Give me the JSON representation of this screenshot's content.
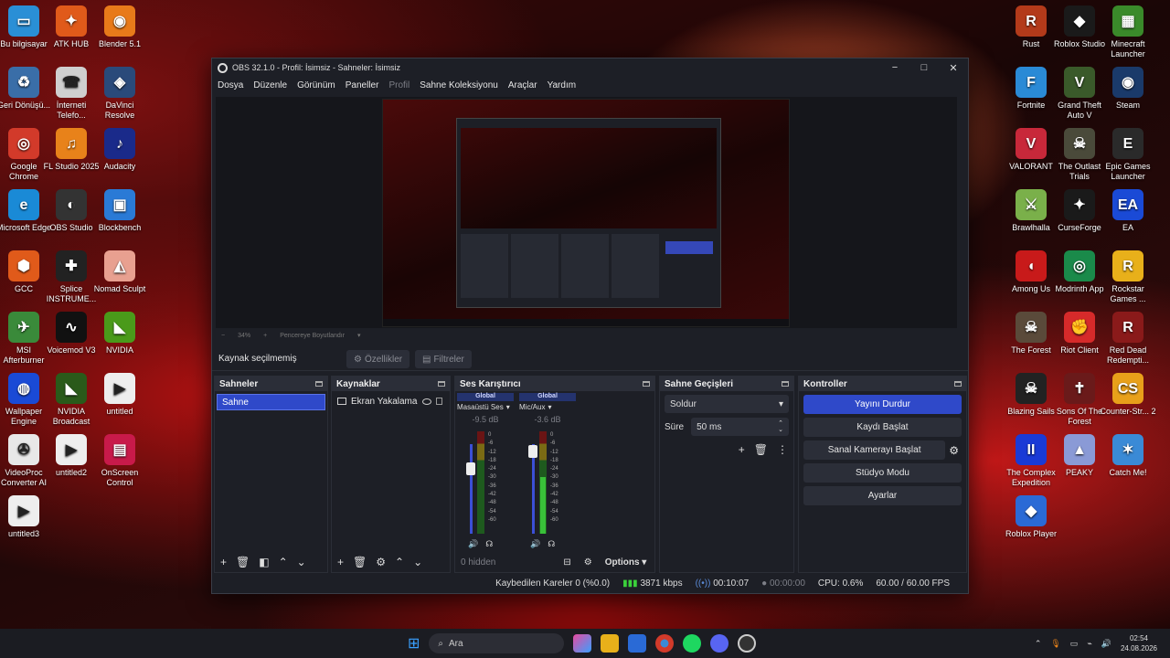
{
  "desktop_left": [
    {
      "label": "Bu bilgisayar",
      "glyph": "▭",
      "color": "#2a8fd6",
      "icon": "computer-icon"
    },
    {
      "label": "ATK HUB",
      "glyph": "✦",
      "color": "#e05a1a",
      "icon": "atk-hub-icon"
    },
    {
      "label": "Blender 5.1",
      "glyph": "◉",
      "color": "#e87a1a",
      "icon": "blender-icon"
    },
    {
      "label": "Geri Dönüşü...",
      "glyph": "♻",
      "color": "#3a6ea8",
      "icon": "recycle-bin-icon"
    },
    {
      "label": "İnterneti Telefo...",
      "glyph": "☎",
      "color": "#cfcfcf",
      "icon": "phone-link-icon"
    },
    {
      "label": "DaVinci Resolve",
      "glyph": "◈",
      "color": "#2a4a7a",
      "icon": "davinci-icon"
    },
    {
      "label": "Google Chrome",
      "glyph": "◎",
      "color": "#d23a2a",
      "icon": "chrome-icon"
    },
    {
      "label": "FL Studio 2025",
      "glyph": "♫",
      "color": "#e8821a",
      "icon": "fl-studio-icon"
    },
    {
      "label": "Audacity",
      "glyph": "♪",
      "color": "#1a2a8a",
      "icon": "audacity-icon"
    },
    {
      "label": "Microsoft Edge",
      "glyph": "e",
      "color": "#1a8ad6",
      "icon": "edge-icon"
    },
    {
      "label": "OBS Studio",
      "glyph": "◐",
      "color": "#333",
      "icon": "obs-icon"
    },
    {
      "label": "Blockbench",
      "glyph": "▣",
      "color": "#2a7ad6",
      "icon": "blockbench-icon"
    },
    {
      "label": "GCC",
      "glyph": "⬢",
      "color": "#e05a1a",
      "icon": "gcc-icon"
    },
    {
      "label": "Splice INSTRUME...",
      "glyph": "✚",
      "color": "#222",
      "icon": "splice-icon"
    },
    {
      "label": "Nomad Sculpt",
      "glyph": "◭",
      "color": "#e8a090",
      "icon": "nomad-icon"
    },
    {
      "label": "MSI Afterburner",
      "glyph": "✈",
      "color": "#3a8a3a",
      "icon": "afterburner-icon"
    },
    {
      "label": "Voicemod V3",
      "glyph": "∿",
      "color": "#111",
      "icon": "voicemod-icon"
    },
    {
      "label": "NVIDIA",
      "glyph": "◣",
      "color": "#4a9a1a",
      "icon": "nvidia-icon"
    },
    {
      "label": "Wallpaper Engine",
      "glyph": "◍",
      "color": "#1a4ad6",
      "icon": "wallpaper-engine-icon"
    },
    {
      "label": "NVIDIA Broadcast",
      "glyph": "◣",
      "color": "#2a5a1a",
      "icon": "nvidia-broadcast-icon"
    },
    {
      "label": "untitled",
      "glyph": "▶",
      "color": "#eee",
      "icon": "video-file-icon"
    },
    {
      "label": "VideoProc Converter AI",
      "glyph": "✇",
      "color": "#e8e8e8",
      "icon": "videoproc-icon"
    },
    {
      "label": "untitled2",
      "glyph": "▶",
      "color": "#eee",
      "icon": "video-file-icon"
    },
    {
      "label": "OnScreen Control",
      "glyph": "▤",
      "color": "#c81a4a",
      "icon": "onscreen-control-icon"
    },
    {
      "label": "untitled3",
      "glyph": "▶",
      "color": "#eee",
      "icon": "video-file-icon"
    }
  ],
  "desktop_right": [
    {
      "label": "Rust",
      "glyph": "R",
      "color": "#b33a1a",
      "icon": "rust-icon"
    },
    {
      "label": "Roblox Studio",
      "glyph": "◆",
      "color": "#1a1a1a",
      "icon": "roblox-studio-icon"
    },
    {
      "label": "Minecraft Launcher",
      "glyph": "▦",
      "color": "#3a8a2a",
      "icon": "minecraft-icon"
    },
    {
      "label": "Fortnite",
      "glyph": "F",
      "color": "#2a8ad6",
      "icon": "fortnite-icon"
    },
    {
      "label": "Grand Theft Auto V",
      "glyph": "V",
      "color": "#3a5a2a",
      "icon": "gta-icon"
    },
    {
      "label": "Steam",
      "glyph": "◉",
      "color": "#1a3a6a",
      "icon": "steam-icon"
    },
    {
      "label": "VALORANT",
      "glyph": "V",
      "color": "#c8283a",
      "icon": "valorant-icon"
    },
    {
      "label": "The Outlast Trials",
      "glyph": "☠",
      "color": "#4a4a3a",
      "icon": "outlast-icon"
    },
    {
      "label": "Epic Games Launcher",
      "glyph": "E",
      "color": "#2a2a2a",
      "icon": "epic-icon"
    },
    {
      "label": "Brawlhalla",
      "glyph": "⚔",
      "color": "#7ab04a",
      "icon": "brawlhalla-icon"
    },
    {
      "label": "CurseForge",
      "glyph": "✦",
      "color": "#1a1a1a",
      "icon": "curseforge-icon"
    },
    {
      "label": "EA",
      "glyph": "EA",
      "color": "#1a4ad6",
      "icon": "ea-icon"
    },
    {
      "label": "Among Us",
      "glyph": "◖",
      "color": "#c81a1a",
      "icon": "among-us-icon"
    },
    {
      "label": "Modrinth App",
      "glyph": "◎",
      "color": "#1a8a4a",
      "icon": "modrinth-icon"
    },
    {
      "label": "Rockstar Games ...",
      "glyph": "R",
      "color": "#e8b01a",
      "icon": "rockstar-icon"
    },
    {
      "label": "The Forest",
      "glyph": "☠",
      "color": "#5a4a3a",
      "icon": "the-forest-icon"
    },
    {
      "label": "Riot Client",
      "glyph": "✊",
      "color": "#d62a2a",
      "icon": "riot-icon"
    },
    {
      "label": "Red Dead Redempti...",
      "glyph": "R",
      "color": "#8a1a1a",
      "icon": "red-dead-icon"
    },
    {
      "label": "Blazing Sails",
      "glyph": "☠",
      "color": "#222",
      "icon": "blazing-sails-icon"
    },
    {
      "label": "Sons Of The Forest",
      "glyph": "✝",
      "color": "#6a1a1a",
      "icon": "sons-forest-icon"
    },
    {
      "label": "Counter-Str... 2",
      "glyph": "CS",
      "color": "#e8a01a",
      "icon": "counter-strike-icon"
    },
    {
      "label": "The Complex Expedition",
      "glyph": "II",
      "color": "#1a3ad6",
      "icon": "complex-icon"
    },
    {
      "label": "PEAKY",
      "glyph": "▲",
      "color": "#8a9ad6",
      "icon": "peaky-icon"
    },
    {
      "label": "Catch Me!",
      "glyph": "✶",
      "color": "#3a8ad6",
      "icon": "catch-me-icon"
    },
    {
      "label": "Roblox Player",
      "glyph": "◆",
      "color": "#2a6ad6",
      "icon": "roblox-player-icon"
    }
  ],
  "obs": {
    "title": "OBS 32.1.0 - Profil: İsimsiz - Sahneler: İsimsiz",
    "window_controls": [
      "−",
      "□",
      "✕"
    ],
    "menu": [
      {
        "label": "Dosya",
        "enabled": true
      },
      {
        "label": "Düzenle",
        "enabled": true
      },
      {
        "label": "Görünüm",
        "enabled": true
      },
      {
        "label": "Paneller",
        "enabled": true
      },
      {
        "label": "Profil",
        "enabled": false
      },
      {
        "label": "Sahne Koleksiyonu",
        "enabled": true
      },
      {
        "label": "Araçlar",
        "enabled": true
      },
      {
        "label": "Yardım",
        "enabled": true
      }
    ],
    "zoom": {
      "minus": "−",
      "value": "34%",
      "plus": "+",
      "fit_label": "Pencereye Boyutlandır"
    },
    "source_status": "Kaynak seçilmemiş",
    "properties_label": "Özellikler",
    "filters_label": "Filtreler",
    "scenes": {
      "title": "Sahneler",
      "items": [
        "Sahne"
      ]
    },
    "sources": {
      "title": "Kaynaklar",
      "items": [
        {
          "name": "Ekran Yakalama"
        }
      ]
    },
    "mixer": {
      "title": "Ses Karıştırıcı",
      "global_label": "Global",
      "scale": [
        "0",
        "-6",
        "-12",
        "-18",
        "-24",
        "-30",
        "-36",
        "-42",
        "-48",
        "-54",
        "-60"
      ],
      "channels": [
        {
          "name": "Masaüstü Ses",
          "db": "-9.5 dB",
          "fader": 0.72,
          "level": 0.0
        },
        {
          "name": "Mic/Aux",
          "db": "-3.6 dB",
          "fader": 0.92,
          "level": 0.55
        }
      ],
      "hidden_label": "0 hidden",
      "options_label": "Options"
    },
    "transitions": {
      "title": "Sahne Geçişleri",
      "selected": "Soldur",
      "duration_label": "Süre",
      "duration_value": "50 ms"
    },
    "controls": {
      "title": "Kontroller",
      "buttons": [
        {
          "label": "Yayını Durdur",
          "primary": true
        },
        {
          "label": "Kaydı Başlat",
          "primary": false
        },
        {
          "label": "Sanal Kamerayı Başlat",
          "primary": false
        },
        {
          "label": "Stüdyo Modu",
          "primary": false
        },
        {
          "label": "Ayarlar",
          "primary": false
        }
      ]
    },
    "status": {
      "dropped": "Kaybedilen Kareler 0 (%0.0)",
      "bitrate": "3871 kbps",
      "stream_time": "00:10:07",
      "rec_time": "00:00:00",
      "cpu": "CPU: 0.6%",
      "fps": "60.00 / 60.00 FPS"
    }
  },
  "taskbar": {
    "search_placeholder": "Ara",
    "time": "02:54",
    "date": "24.08.2026"
  }
}
